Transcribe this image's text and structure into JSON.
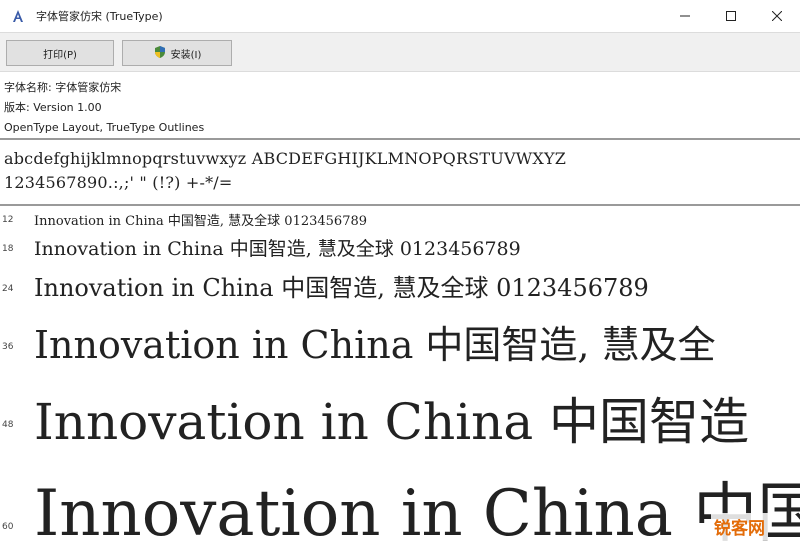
{
  "window": {
    "title": "字体管家仿宋 (TrueType)",
    "controls": [
      "minimize",
      "maximize",
      "close"
    ]
  },
  "toolbar": {
    "print_label": "打印(P)",
    "install_label": "安装(I)"
  },
  "info": {
    "font_name": "字体名称: 字体管家仿宋",
    "version": "版本: Version 1.00",
    "outline": "OpenType Layout, TrueType Outlines"
  },
  "charset": {
    "line1": "abcdefghijklmnopqrstuvwxyz ABCDEFGHIJKLMNOPQRSTUVWXYZ",
    "line2": "1234567890.:,;' \" (!?) +-*/="
  },
  "samples": [
    {
      "size": "12",
      "text": "Innovation in China 中国智造, 慧及全球 0123456789"
    },
    {
      "size": "18",
      "text": "Innovation in China 中国智造, 慧及全球 0123456789"
    },
    {
      "size": "24",
      "text": "Innovation in China 中国智造, 慧及全球 0123456789"
    },
    {
      "size": "36",
      "text": "Innovation in China 中国智造, 慧及全"
    },
    {
      "size": "48",
      "text": "Innovation in China 中国智造"
    },
    {
      "size": "60",
      "text": "Innovation in China 中国"
    }
  ],
  "watermark": "锐客网",
  "colors": {
    "toolbar_bg": "#f0f0f0",
    "button_bg": "#e1e1e1",
    "divider": "#9a9a9a",
    "watermark": "#e36c09"
  }
}
